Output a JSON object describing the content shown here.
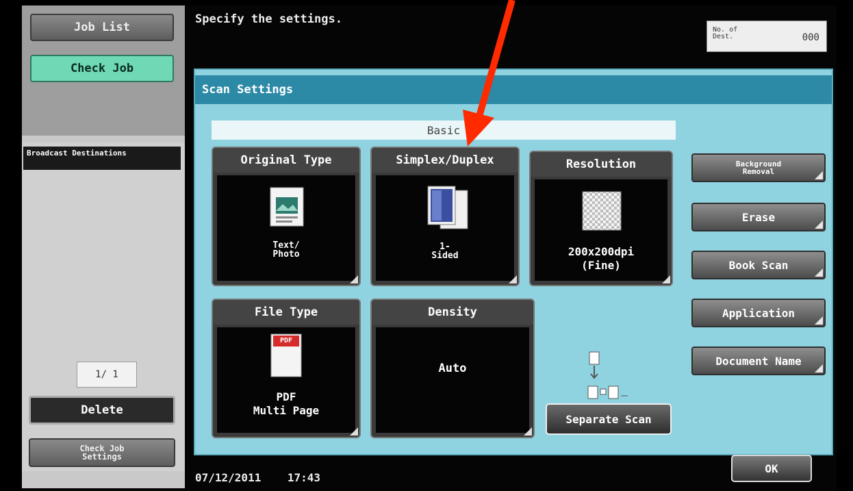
{
  "sidebar": {
    "job_list": "Job List",
    "check_job": "Check Job",
    "broadcast": "Broadcast Destinations",
    "pager": "1/  1",
    "delete": "Delete",
    "check_job_settings": "Check Job Settings"
  },
  "header": {
    "prompt": "Specify the settings.",
    "dest_label": "No. of Dest.",
    "dest_count": "000"
  },
  "panel": {
    "title": "Scan Settings",
    "section": "Basic"
  },
  "tiles": {
    "original_type": {
      "label": "Original Type",
      "value": "Text/ Photo",
      "icon": "photo-page-icon"
    },
    "simplex_duplex": {
      "label": "Simplex/Duplex",
      "value": "1- Sided",
      "icon": "pages-icon"
    },
    "resolution": {
      "label": "Resolution",
      "value_line1": "200x200dpi",
      "value_line2": "(Fine)",
      "icon": "checker-icon"
    },
    "file_type": {
      "label": "File Type",
      "badge": "PDF",
      "value_line1": "PDF",
      "value_line2": "Multi Page",
      "icon": "pdf-file-icon"
    },
    "density": {
      "label": "Density",
      "value": "Auto"
    }
  },
  "right_buttons": {
    "background_removal": "Background Removal",
    "erase": "Erase",
    "book_scan": "Book Scan",
    "application": "Application",
    "document_name": "Document Name"
  },
  "separate_scan": "Separate Scan",
  "footer": {
    "date": "07/12/2011",
    "time": "17:43",
    "ok": "OK"
  },
  "colors": {
    "panel_bg": "#8fd3e1",
    "title_bar": "#2c8aa7",
    "check_job_green": "#6fd8b4",
    "annotation_arrow": "#ff2a00"
  }
}
